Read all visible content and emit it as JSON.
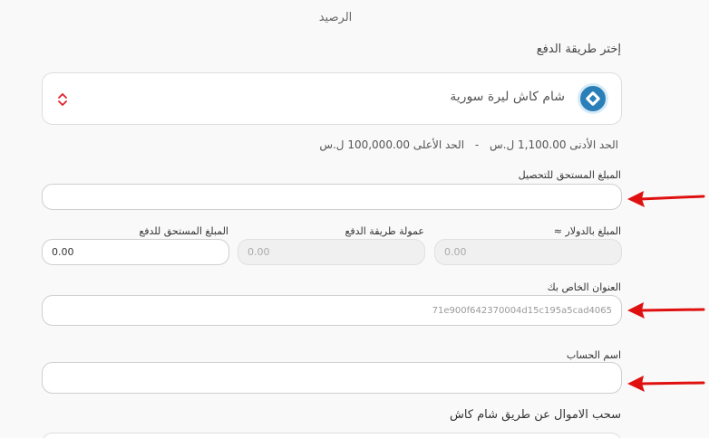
{
  "balance_label": "الرصيد",
  "payment_method": {
    "label": "إختر طريقة الدفع",
    "selected": "شام كاش ليرة سورية",
    "logo_icon": "sham-cash-logo-icon",
    "chevron_icon": "updown-chevron-icon",
    "chevron_color": "#e0202a"
  },
  "limits": {
    "min_text": "الحد الأدنى 1,100.00 ل.س",
    "separator": "-",
    "max_text": "الحد الأعلى 100,000.00 ل.س"
  },
  "fields": {
    "amount_due_label": "المبلغ المستحق للتحصيل",
    "amount_due_value": "",
    "usd_amount_label": "المبلغ بالدولار ≈",
    "usd_amount_value": "0.00",
    "method_fee_label": "عمولة طريقة الدفع",
    "method_fee_value": "0.00",
    "amount_payable_label": "المبلغ المستحق للدفع",
    "amount_payable_value": "0.00",
    "address_label": "العنوان الخاص بك",
    "address_value": "71e900f642370004d15c195a5cad4065",
    "account_name_label": "اسم الحساب",
    "account_name_value": ""
  },
  "withdraw_title": "سحب الاموال عن طريق شام كاش",
  "arrow_color": "#e01010"
}
